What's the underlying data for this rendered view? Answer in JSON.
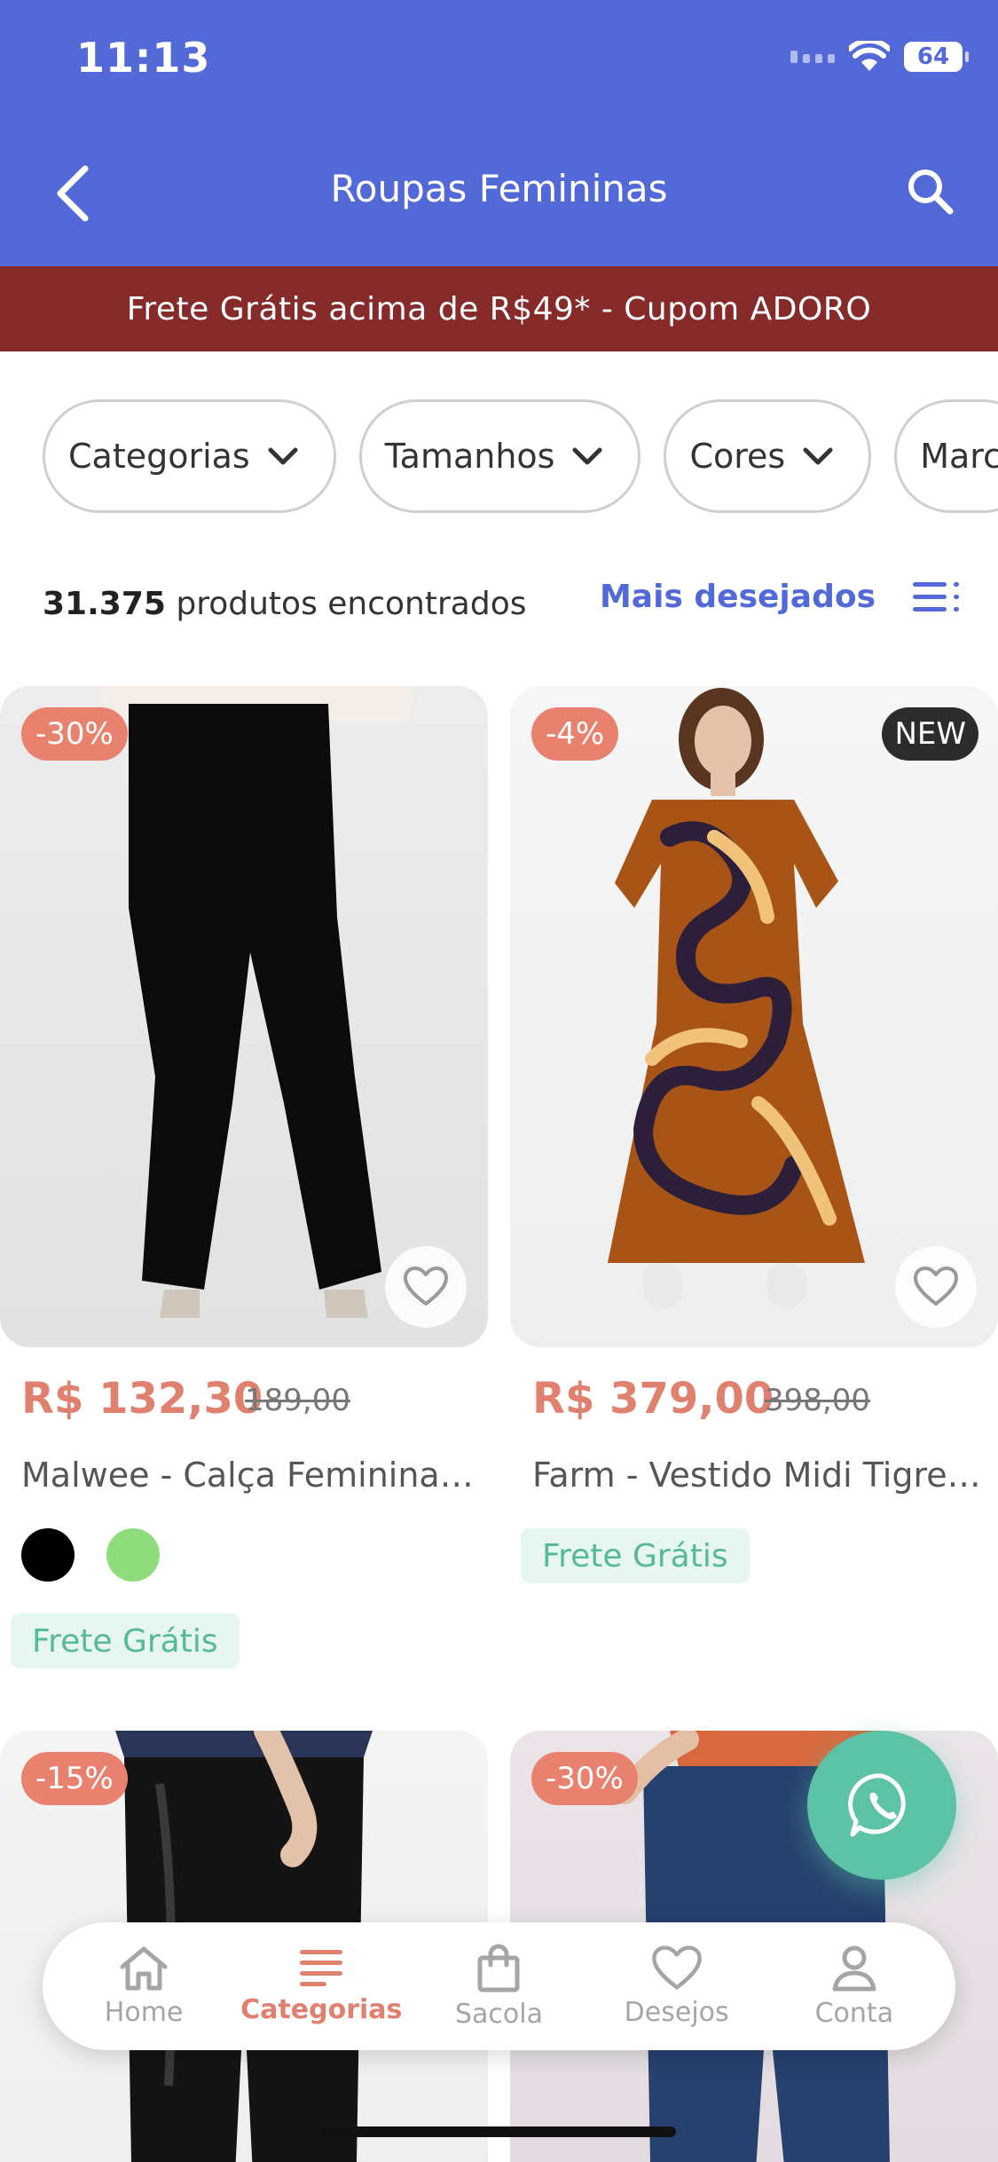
{
  "status_bar": {
    "time": "11:13",
    "battery": "64"
  },
  "header": {
    "title": "Roupas Femininas"
  },
  "promo_banner": "Frete Grátis acima de R$49* - Cupom ADORO",
  "filters": [
    {
      "label": "Categorias"
    },
    {
      "label": "Tamanhos"
    },
    {
      "label": "Cores"
    },
    {
      "label": "Marc"
    }
  ],
  "results": {
    "count": "31.375",
    "text": "produtos encontrados"
  },
  "sort": {
    "label": "Mais desejados"
  },
  "products": [
    {
      "discount": "-30%",
      "price": "R$ 132,30",
      "old_price": "189,00",
      "name": "Malwee - Calça Feminina Flare Jeans Preta",
      "colors": [
        "#000000",
        "#8fdc7d"
      ],
      "shipping": "Frete Grátis"
    },
    {
      "discount": "-4%",
      "badge": "NEW",
      "price": "R$ 379,00",
      "old_price": "398,00",
      "name": "Farm - Vestido Midi Tigre Estampado",
      "shipping": "Frete Grátis"
    },
    {
      "discount": "-15%"
    },
    {
      "discount": "-30%"
    }
  ],
  "bottom_nav": [
    {
      "label": "Home",
      "icon": "home-icon"
    },
    {
      "label": "Categorias",
      "icon": "list-icon"
    },
    {
      "label": "Sacola",
      "icon": "bag-icon"
    },
    {
      "label": "Desejos",
      "icon": "heart-icon"
    },
    {
      "label": "Conta",
      "icon": "user-icon"
    }
  ],
  "colors": {
    "brand": "#5369d8",
    "promo": "#862a2a",
    "accent": "#e0806f",
    "whatsapp": "#5cc3a6"
  }
}
